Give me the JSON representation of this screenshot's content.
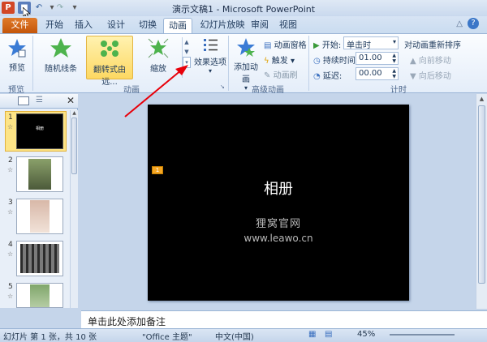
{
  "window": {
    "title": "演示文稿1 - Microsoft PowerPoint"
  },
  "tabs": [
    "文件",
    "开始",
    "插入",
    "设计",
    "切换",
    "动画",
    "幻灯片放映",
    "审阅",
    "视图"
  ],
  "ribbon": {
    "preview": {
      "label": "预览",
      "group": "预览"
    },
    "animations": {
      "items": [
        "随机线条",
        "翻转式由远...",
        "缩放"
      ],
      "effect_options": "效果选项",
      "group": "动画"
    },
    "advanced": {
      "add": "添加动画",
      "pane": "动画窗格",
      "trigger": "触发",
      "painter": "动画刷",
      "group": "高级动画"
    },
    "timing": {
      "start_label": "开始:",
      "start_value": "单击时",
      "duration_label": "持续时间:",
      "duration_value": "01.00",
      "delay_label": "延迟:",
      "delay_value": "00.00",
      "reorder": "对动画重新排序",
      "forward": "向前移动",
      "backward": "向后移动",
      "group": "计时"
    }
  },
  "thumbnails": {
    "numbers": [
      "1",
      "2",
      "3",
      "4",
      "5"
    ],
    "slide1_title": "相册"
  },
  "slide": {
    "title": "相册",
    "subtitle": "狸窝官网",
    "url": "www.leawo.cn"
  },
  "notes": {
    "placeholder": "单击此处添加备注"
  },
  "status": {
    "left": "幻灯片 第 1 张，共 10 张",
    "theme": "\"Office 主题\"",
    "lang": "中文(中国)",
    "zoom": "45%"
  },
  "colors": {
    "file_tab": "#d2601a",
    "highlight": "#fde486",
    "arrow": "#e8000a"
  }
}
